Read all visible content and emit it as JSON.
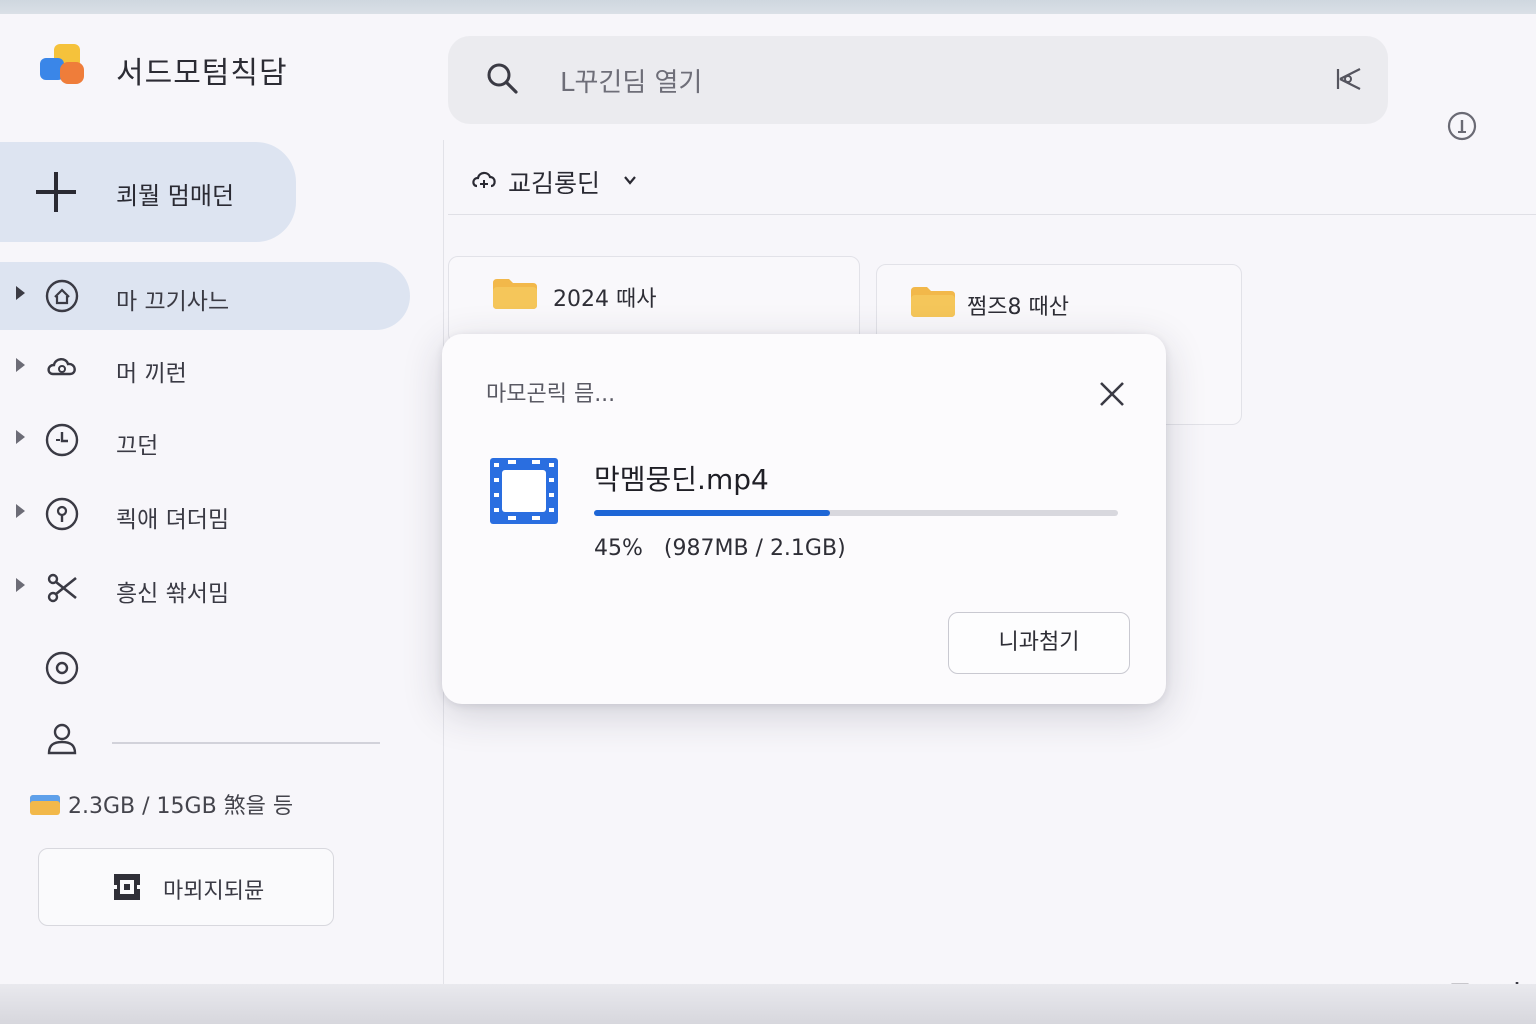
{
  "app": {
    "title": "서드모텀칙담"
  },
  "search": {
    "placeholder": "L꾸긴딤 열기"
  },
  "sidebar": {
    "new_label": "쾨뭘 멈매던",
    "items": [
      {
        "label": "마 끄기사느",
        "icon": "home-circle-icon",
        "active": true
      },
      {
        "label": "머 끼런",
        "icon": "cloud-share-icon",
        "active": false
      },
      {
        "label": "끄던",
        "icon": "clock-circle-icon",
        "active": false
      },
      {
        "label": "쾩애 뎌더밈",
        "icon": "lock-circle-icon",
        "active": false
      },
      {
        "label": "흥신 쏶서밈",
        "icon": "scissors-icon",
        "active": false
      }
    ],
    "extra_icons": [
      "settings-circle-icon",
      "person-icon"
    ],
    "storage_text": "2.3GB / 15GB 煞을 등",
    "upgrade_label": "마뫼지되뮨"
  },
  "main": {
    "location_label": "교김롱딘",
    "folders": [
      {
        "name": "2024 때사"
      },
      {
        "name": "쩜즈8 때산"
      }
    ]
  },
  "dialog": {
    "title": "마모곤릭 믐...",
    "file_name": "막멤뭉딘.mp4",
    "progress": 45,
    "percent_text": "45%",
    "size_text": "(987MB / 2.1GB)",
    "cancel_label": "니과첨기"
  },
  "colors": {
    "accent": "#1e66d6",
    "active_nav_bg": "#dde4f1",
    "folder": "#f2b84a"
  }
}
